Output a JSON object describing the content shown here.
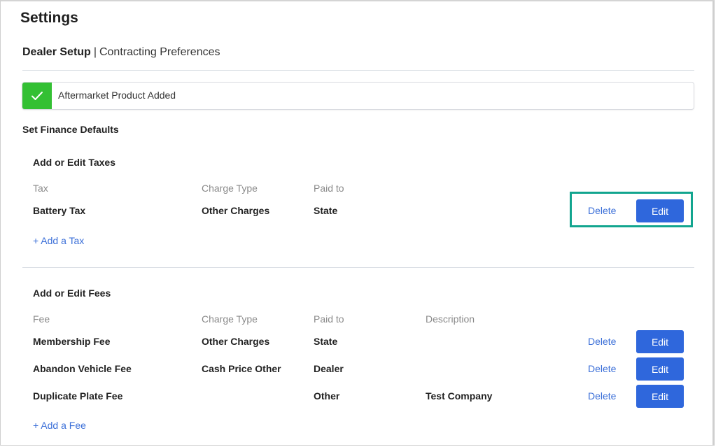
{
  "page": {
    "title": "Settings",
    "breadcrumb": {
      "current": "Dealer Setup",
      "separator": "|",
      "next": "Contracting Preferences"
    }
  },
  "toast": {
    "icon": "check-icon",
    "message": "Aftermarket Product Added",
    "color": "#33c033"
  },
  "finance": {
    "heading": "Set Finance Defaults"
  },
  "taxes": {
    "heading": "Add or Edit Taxes",
    "columns": [
      "Tax",
      "Charge Type",
      "Paid to"
    ],
    "rows": [
      {
        "name": "Battery Tax",
        "charge_type": "Other Charges",
        "paid_to": "State",
        "delete_label": "Delete",
        "edit_label": "Edit",
        "highlighted": true
      }
    ],
    "add_label": "+ Add a Tax"
  },
  "fees": {
    "heading": "Add or Edit Fees",
    "columns": [
      "Fee",
      "Charge Type",
      "Paid to",
      "Description"
    ],
    "rows": [
      {
        "name": "Membership Fee",
        "charge_type": "Other Charges",
        "paid_to": "State",
        "description": "",
        "delete_label": "Delete",
        "edit_label": "Edit"
      },
      {
        "name": "Abandon Vehicle Fee",
        "charge_type": "Cash Price Other",
        "paid_to": "Dealer",
        "description": "",
        "delete_label": "Delete",
        "edit_label": "Edit"
      },
      {
        "name": "Duplicate Plate Fee",
        "charge_type": "",
        "paid_to": "Other",
        "description": "Test Company",
        "delete_label": "Delete",
        "edit_label": "Edit"
      }
    ],
    "add_label": "+ Add a Fee"
  },
  "colors": {
    "accent": "#2f67dc",
    "link": "#3b6fd8",
    "highlight": "#12a58f",
    "success": "#33c033"
  }
}
